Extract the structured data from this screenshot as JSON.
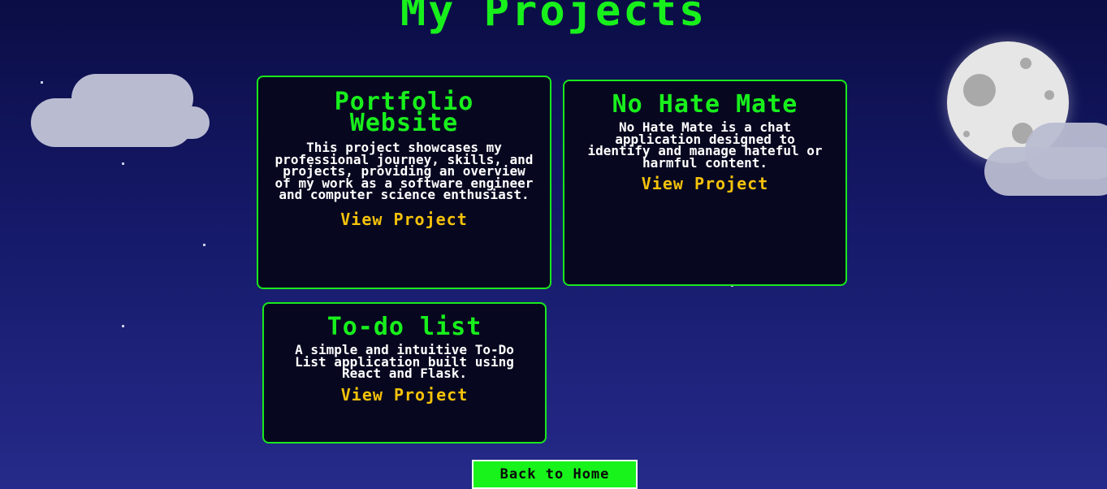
{
  "header": {
    "title": "My Projects"
  },
  "projects": [
    {
      "title": "Portfolio Website",
      "description": "This project showcases my professional journey, skills, and projects, providing an overview of my work as a software engineer and computer science enthusiast.",
      "link_label": "View Project"
    },
    {
      "title": "No Hate Mate",
      "description": "No Hate Mate is a chat application designed to identify and manage hateful or harmful content.",
      "link_label": "View Project"
    },
    {
      "title": "To-do list",
      "description": "A simple and intuitive To-Do List application built using React and Flask.",
      "link_label": "View Project"
    }
  ],
  "footer": {
    "back_label": "Back to Home"
  },
  "colors": {
    "accent": "#18f01c",
    "link": "#f5c20a",
    "background_top": "#0b0d45",
    "background_bottom": "#262a8a"
  },
  "decorations": {
    "moon": "moon-icon",
    "clouds": "cloud-icon",
    "stars": "star-icon"
  }
}
